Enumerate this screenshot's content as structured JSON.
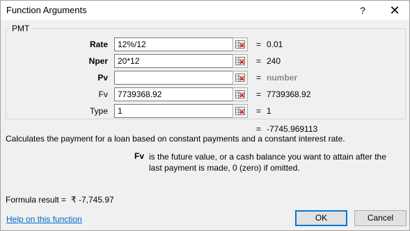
{
  "window": {
    "title": "Function Arguments",
    "help_glyph": "?",
    "close_glyph": "✕"
  },
  "group": {
    "label": "PMT"
  },
  "args": [
    {
      "label": "Rate",
      "value": "12%/12",
      "placeholder": "",
      "result": "0.01",
      "required": true
    },
    {
      "label": "Nper",
      "value": "20*12",
      "placeholder": "",
      "result": "240",
      "required": true
    },
    {
      "label": "Pv",
      "value": "",
      "placeholder": "",
      "result": "number",
      "required": true
    },
    {
      "label": "Fv",
      "value": "7739368.92",
      "placeholder": "",
      "result": "7739368.92",
      "required": false
    },
    {
      "label": "Type",
      "value": "1",
      "placeholder": "",
      "result": "1",
      "required": false
    }
  ],
  "equals_sign": "=",
  "function_result": "-7745.969113",
  "description": "Calculates the payment for a loan based on constant payments and a constant interest rate.",
  "arg_help": {
    "name": "Fv",
    "text": "is the future value, or a cash balance you want to attain after the last payment is made, 0 (zero) if omitted."
  },
  "formula_result": {
    "label": "Formula result =",
    "value": "₹ -7,745.97"
  },
  "footer": {
    "help_link": "Help on this function",
    "ok": "OK",
    "cancel": "Cancel"
  },
  "icons": {
    "collapse_dialog": "range-select-icon"
  },
  "colors": {
    "link": "#0066cc",
    "hint": "#8a8a8a",
    "ok_border": "#0078d7"
  }
}
